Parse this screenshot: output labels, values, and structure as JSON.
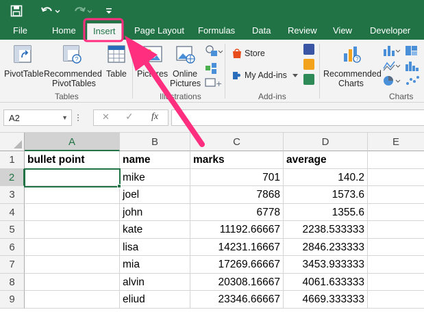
{
  "colors": {
    "brand": "#217346",
    "annotation": "#ff2e7e"
  },
  "quick_access": {
    "save_icon": "save-icon",
    "undo_icon": "undo-icon",
    "redo_icon": "redo-icon",
    "customize_icon": "customize-icon"
  },
  "tabs": [
    "File",
    "Home",
    "Insert",
    "Page Layout",
    "Formulas",
    "Data",
    "Review",
    "View",
    "Developer"
  ],
  "active_tab": "Insert",
  "ribbon": {
    "tables": {
      "pivottable": "PivotTable",
      "recommended_line1": "Recommended",
      "recommended_line2": "PivotTables",
      "table": "Table",
      "group": "Tables"
    },
    "illustrations": {
      "pictures": "Pictures",
      "online_line1": "Online",
      "online_line2": "Pictures",
      "group": "Illustrations"
    },
    "addins": {
      "store": "Store",
      "my_addins": "My Add-ins",
      "group": "Add-ins"
    },
    "charts": {
      "recommended_line1": "Recommended",
      "recommended_line2": "Charts",
      "group": "Charts"
    }
  },
  "formula_bar": {
    "name_box": "A2",
    "cancel": "✕",
    "enter": "✓",
    "fx": "fx",
    "formula": ""
  },
  "grid": {
    "columns": [
      "A",
      "B",
      "C",
      "D",
      "E"
    ],
    "rows": [
      {
        "n": "1",
        "a": "bullet point",
        "b": "name",
        "c": "marks",
        "d": "average"
      },
      {
        "n": "2",
        "a": "",
        "b": "mike",
        "c": "701",
        "d": "140.2"
      },
      {
        "n": "3",
        "a": "",
        "b": "joel",
        "c": "7868",
        "d": "1573.6"
      },
      {
        "n": "4",
        "a": "",
        "b": "john",
        "c": "6778",
        "d": "1355.6"
      },
      {
        "n": "5",
        "a": "",
        "b": "kate",
        "c": "11192.66667",
        "d": "2238.533333"
      },
      {
        "n": "6",
        "a": "",
        "b": "lisa",
        "c": "14231.16667",
        "d": "2846.233333"
      },
      {
        "n": "7",
        "a": "",
        "b": "mia",
        "c": "17269.66667",
        "d": "3453.933333"
      },
      {
        "n": "8",
        "a": "",
        "b": "alvin",
        "c": "20308.16667",
        "d": "4061.633333"
      },
      {
        "n": "9",
        "a": "",
        "b": "eliud",
        "c": "23346.66667",
        "d": "4669.333333"
      }
    ]
  }
}
